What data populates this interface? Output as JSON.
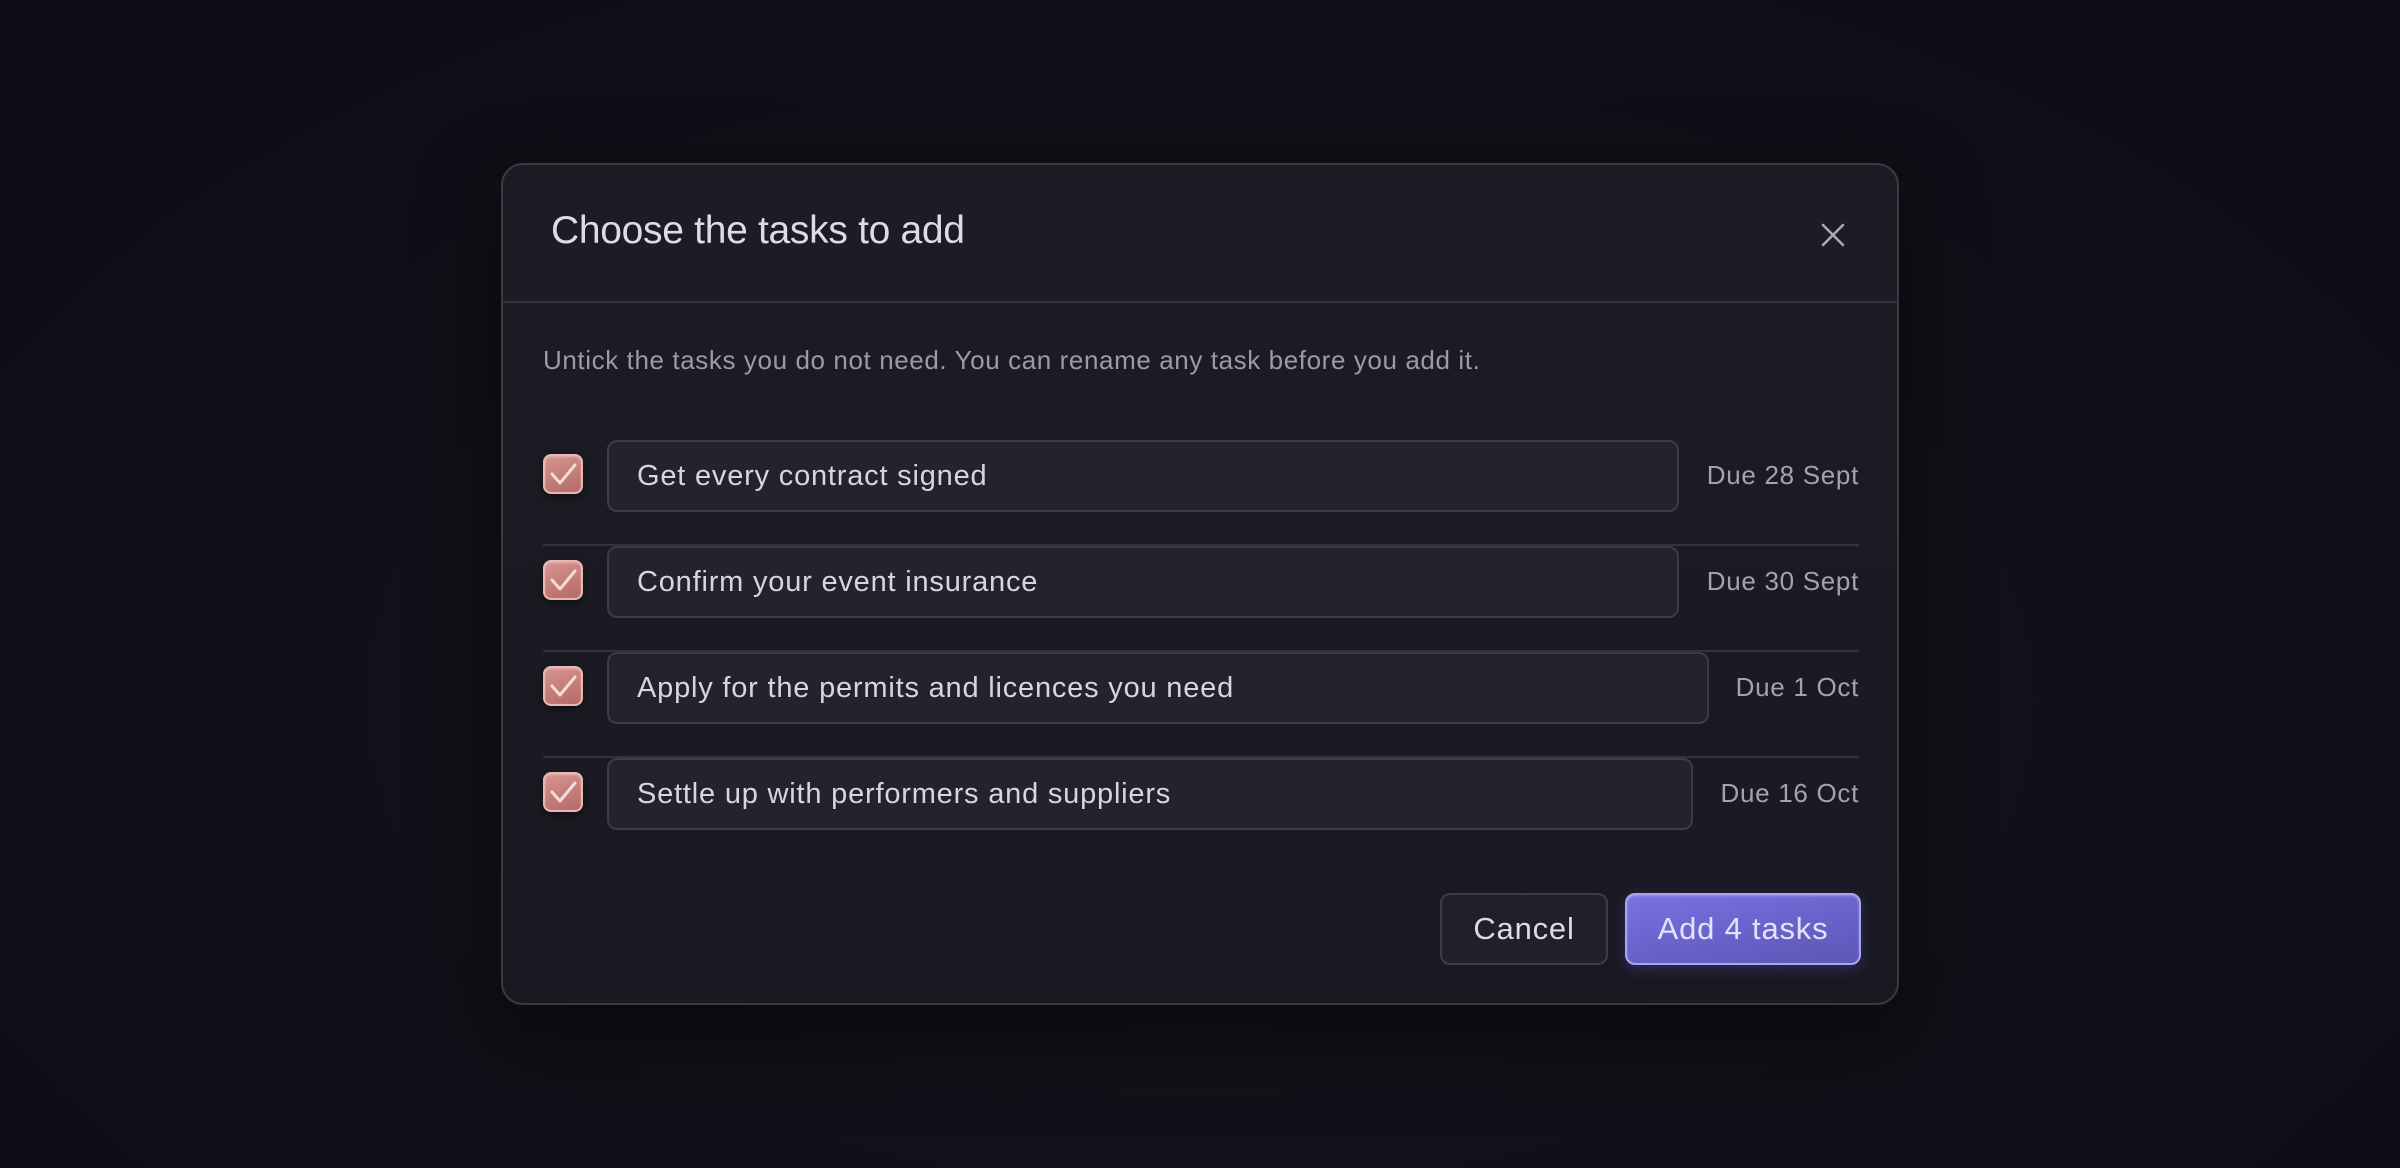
{
  "dialog": {
    "title": "Choose the tasks to add",
    "close_icon": "close-icon",
    "subtitle": "Untick the tasks you do not need. You can rename any task before you add it."
  },
  "tasks": [
    {
      "name": "Get every contract signed",
      "due": "Due 28 Sept",
      "checked": true
    },
    {
      "name": "Confirm your event insurance",
      "due": "Due 30 Sept",
      "checked": true
    },
    {
      "name": "Apply for the permits and licences you need",
      "due": "Due 1 Oct",
      "checked": true
    },
    {
      "name": "Settle up with performers and suppliers",
      "due": "Due 16 Oct",
      "checked": true
    }
  ],
  "footer": {
    "cancel_label": "Cancel",
    "add_label": "Add 4 tasks"
  },
  "colors": {
    "accent": "#7069d6",
    "checkbox": "#c98580",
    "background": "#111119",
    "dialog": "#1c1c25"
  }
}
